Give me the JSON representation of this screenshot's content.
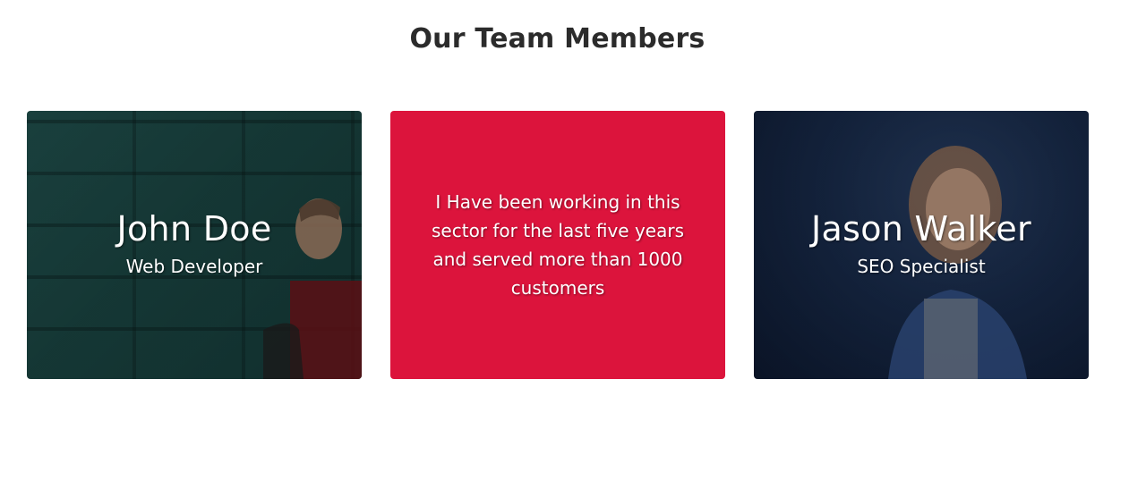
{
  "section": {
    "title": "Our Team Members"
  },
  "cards": [
    {
      "name": "John Doe",
      "role": "Web Developer"
    },
    {
      "quote": "I Have been working in this sector for the last five years and served more than 1000 customers"
    },
    {
      "name": "Jason Walker",
      "role": "SEO Specialist"
    }
  ],
  "colors": {
    "accent": "#dc143c",
    "title": "#2b2b2b"
  }
}
